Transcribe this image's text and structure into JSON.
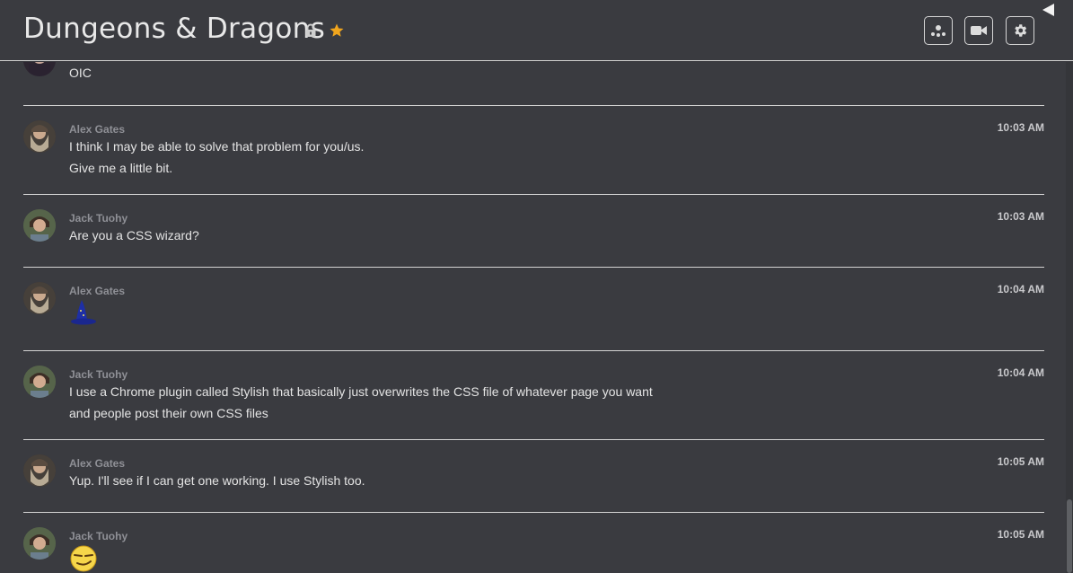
{
  "header": {
    "title": "Dungeons & Dragons",
    "buttons": [
      "people-icon",
      "video-icon",
      "gear-icon"
    ]
  },
  "messages": [
    {
      "author": "",
      "time": "",
      "lines": [
        "OIC"
      ],
      "avatar": "avatar-partial"
    },
    {
      "author": "Alex Gates",
      "time": "10:03 AM",
      "lines": [
        "I think I may be able to solve that problem for you/us.",
        "Give me a little bit."
      ],
      "avatar": "alex"
    },
    {
      "author": "Jack Tuohy",
      "time": "10:03 AM",
      "lines": [
        "Are you a CSS wizard?"
      ],
      "avatar": "jack"
    },
    {
      "author": "Alex Gates",
      "time": "10:04 AM",
      "lines": [],
      "emoji": "wizard-hat-emoji",
      "avatar": "alex"
    },
    {
      "author": "Jack Tuohy",
      "time": "10:04 AM",
      "lines": [
        "I use a Chrome plugin called Stylish that basically just overwrites the CSS file of whatever page you want",
        "and people post their own CSS files"
      ],
      "avatar": "jack"
    },
    {
      "author": "Alex Gates",
      "time": "10:05 AM",
      "lines": [
        "Yup. I'll see if I can get one working. I use Stylish too."
      ],
      "avatar": "alex"
    },
    {
      "author": "Jack Tuohy",
      "time": "10:05 AM",
      "lines": [],
      "emoji": "smirk-face-emoji",
      "avatar": "jack"
    }
  ],
  "colors": {
    "background": "#3a3b40",
    "star": "#f0a51d",
    "author": "#8f9096",
    "divider": "#d4d4d4"
  }
}
